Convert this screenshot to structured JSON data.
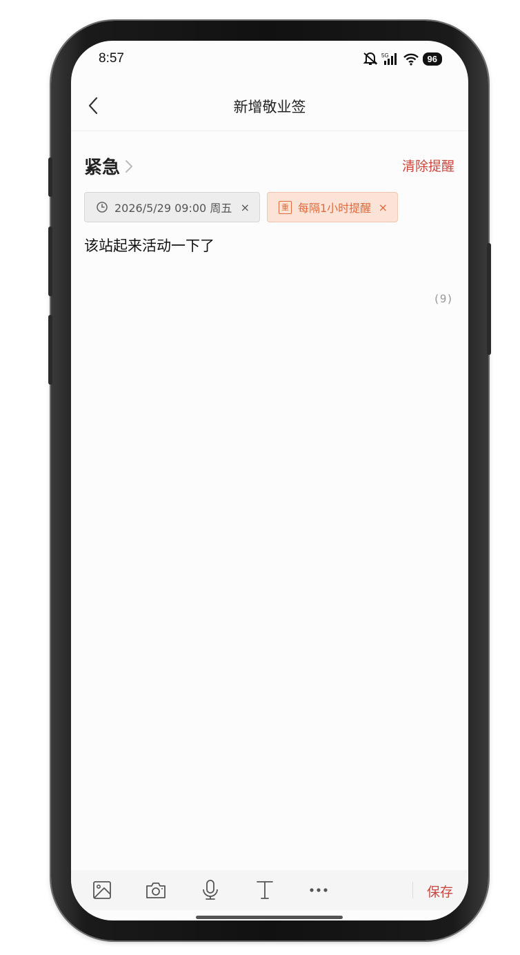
{
  "status_bar": {
    "time": "8:57",
    "icons": [
      "mute-icon",
      "5g-signal-icon",
      "wifi-icon"
    ],
    "battery": "96"
  },
  "nav": {
    "title": "新增敬业签",
    "back_icon": "chevron-left-icon"
  },
  "category": {
    "label": "紧急",
    "arrow_icon": "chevron-right-icon"
  },
  "clear_reminder_label": "清除提醒",
  "tags": {
    "date": {
      "icon": "clock-icon",
      "text": "2026/5/29 09:00 周五",
      "close": "×"
    },
    "repeat": {
      "icon": "repeat-badge-icon",
      "icon_char": "重",
      "text": "每隔1小时提醒",
      "close": "×"
    }
  },
  "note": {
    "text": "该站起来活动一下了",
    "char_count": "(9)"
  },
  "toolbar": {
    "tools": [
      "image-icon",
      "camera-icon",
      "microphone-icon",
      "text-format-icon",
      "more-icon"
    ],
    "save_label": "保存"
  },
  "colors": {
    "accent": "#c9473f",
    "repeat_tag_text": "#e06a3b",
    "repeat_tag_bg": "#fbe3d7",
    "date_tag_bg": "#ededed"
  }
}
